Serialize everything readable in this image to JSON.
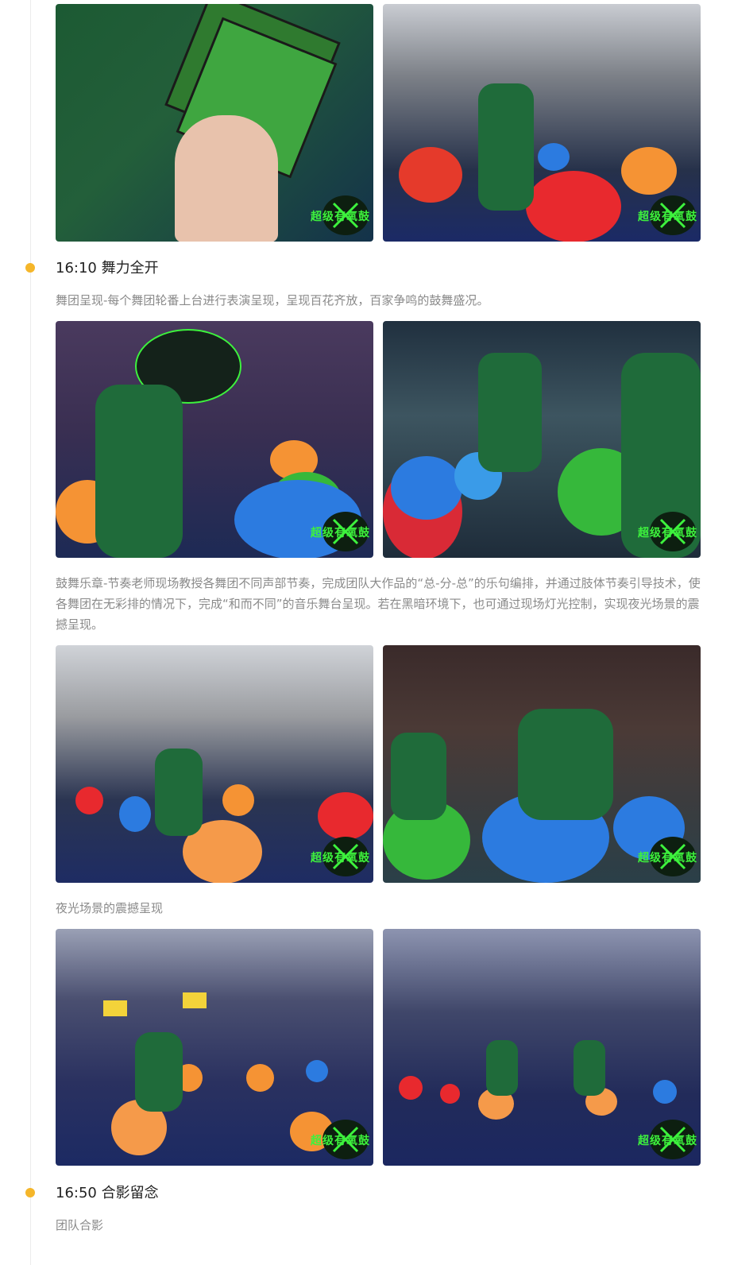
{
  "sections": [
    {
      "time_title": "16:10 舞力全开",
      "desc": "舞团呈现-每个舞团轮番上台进行表演呈现，呈现百花齐放，百家争鸣的鼓舞盛况。"
    },
    {
      "time_title": "16:50 合影留念",
      "desc": "团队合影"
    }
  ],
  "paragraphs": {
    "drum_chapter": "鼓舞乐章-节奏老师现场教授各舞团不同声部节奏，完成团队大作品的“总-分-总”的乐句编排，并通过肢体节奏引导技术，使各舞团在无彩排的情况下，完成“和而不同”的音乐舞台呈现。若在黑暗环境下，也可通过现场灯光控制，实现夜光场景的震撼呈现。",
    "night_scene": "夜光场景的震撼呈现"
  },
  "photo_brand": "超级有氧鼓",
  "colors": {
    "accent_dot": "#f5b62a",
    "brand_green": "#3df23d",
    "shirt_green": "#1f6b3a"
  }
}
